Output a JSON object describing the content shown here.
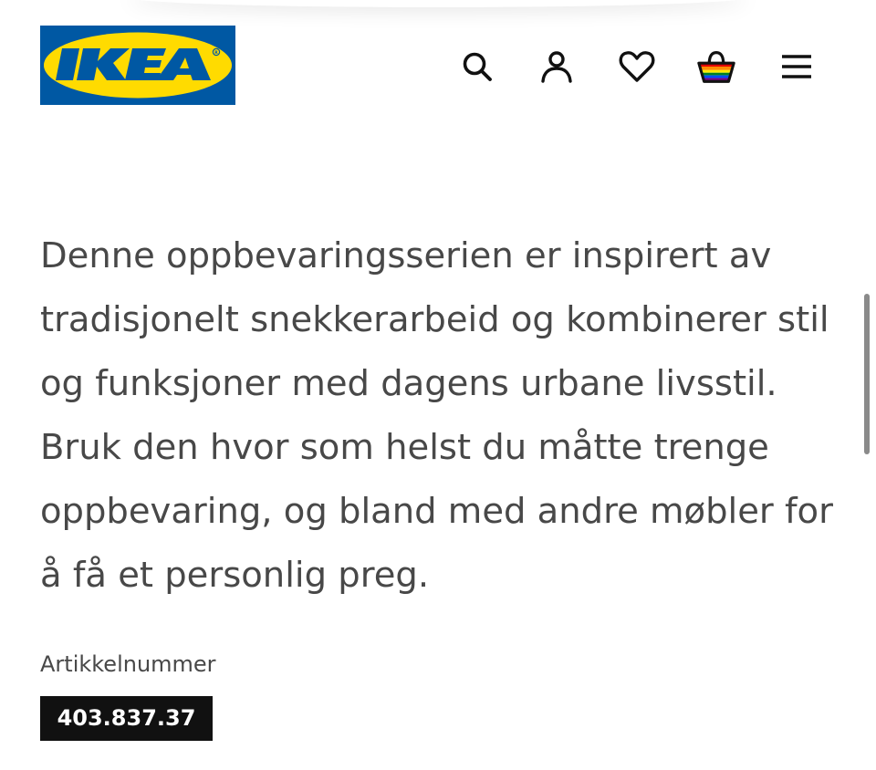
{
  "header": {
    "logo_text": "IKEA",
    "logo_colors": {
      "background": "#0058A3",
      "ellipse": "#FFDB00",
      "text": "#0058A3"
    },
    "icons": [
      {
        "name": "search-icon"
      },
      {
        "name": "user-icon"
      },
      {
        "name": "heart-icon"
      },
      {
        "name": "shopping-basket-icon"
      },
      {
        "name": "menu-icon"
      }
    ]
  },
  "product": {
    "description": "Denne oppbevaringsserien er inspirert av tradisjonelt snekkerarbeid og kombinerer stil og funksjoner med dagens urbane livsstil. Bruk den hvor som helst du måtte trenge oppbevaring, og bland med andre møbler for å få et personlig preg.",
    "article_label": "Artikkelnummer",
    "article_number": "403.837.37"
  },
  "colors": {
    "text": "#484848",
    "article_number_bg": "#111111",
    "article_number_text": "#FFFFFF",
    "basket_rainbow": [
      "#E40303",
      "#FF8C00",
      "#FFED00",
      "#008026",
      "#004DFF",
      "#750787"
    ]
  }
}
